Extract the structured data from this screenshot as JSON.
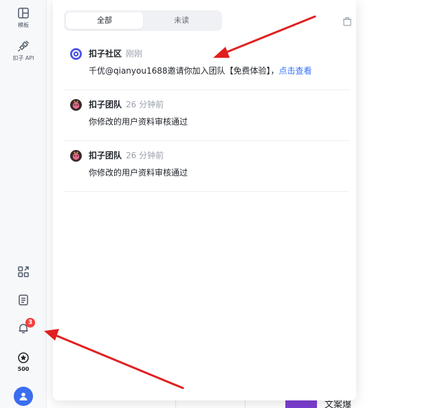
{
  "sidebar": {
    "template_label": "模板",
    "api_label": "扣子 API",
    "notification_badge": "3",
    "credits": "500"
  },
  "tabs": [
    {
      "label": "全部",
      "active": true
    },
    {
      "label": "未读",
      "active": false
    }
  ],
  "notifications": [
    {
      "sender": "扣子社区",
      "time": "刚刚",
      "message": "千优@qianyou1688邀请你加入团队【免费体验】，",
      "link": "点击查看"
    },
    {
      "sender": "扣子团队",
      "time": "26 分钟前",
      "message": "你修改的用户资料审核通过"
    },
    {
      "sender": "扣子团队",
      "time": "26 分钟前",
      "message": "你修改的用户资料审核通过"
    }
  ],
  "background": {
    "card_title_fragment": "文案爆"
  },
  "colors": {
    "accent": "#3370ff",
    "badge": "#f53f3f",
    "annotation_arrow": "#e02020"
  }
}
